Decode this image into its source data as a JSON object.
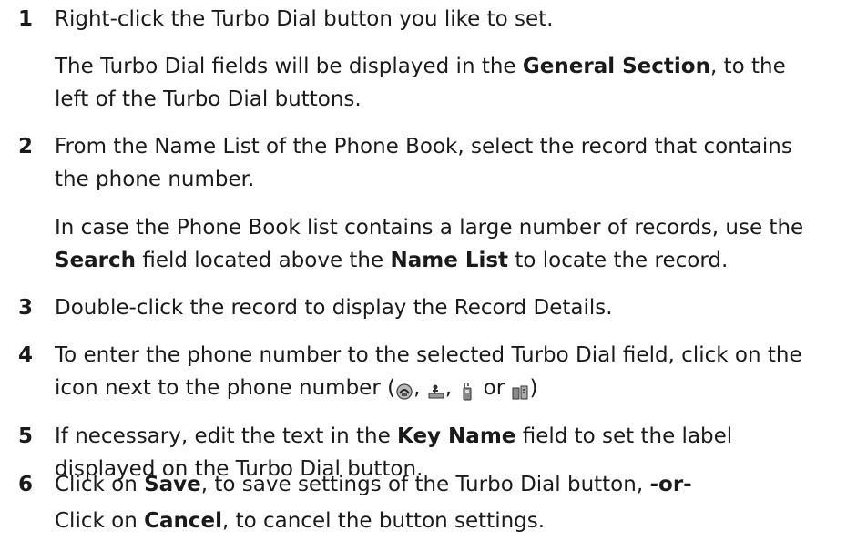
{
  "steps": [
    {
      "number": "1",
      "text": "Right-click the Turbo Dial button you like to set.",
      "note": {
        "line1_pre": "The Turbo Dial fields will be displayed in the ",
        "line1_bold": "General Section",
        "line1_post": ", to the",
        "line2": "left of the Turbo Dial buttons."
      }
    },
    {
      "number": "2",
      "line1": "From the Name List of the Phone Book, select the record that contains",
      "line2": "the phone number.",
      "note": {
        "line1": "In case the Phone Book list contains a large number of records, use the",
        "line2_bold1": "Search",
        "line2_mid": " field located above the ",
        "line2_bold2": "Name List",
        "line2_post": " to locate the record."
      }
    },
    {
      "number": "3",
      "text": "Double-click the record to display the Record Details."
    },
    {
      "number": "4",
      "line1": "To enter the phone number to the selected Turbo Dial field, click on the",
      "line2_pre": "icon next to the phone number (",
      "sep1": ", ",
      "sep2": ", ",
      "sep3": " or ",
      "line2_post": ")",
      "icons": [
        "home-phone-icon",
        "work-phone-icon",
        "mobile-phone-icon",
        "other-phone-icon"
      ]
    },
    {
      "number": "5",
      "line1_pre": "If necessary, edit the text in the ",
      "line1_bold": "Key Name",
      "line1_post": " field to set the label",
      "line2": "displayed on the Turbo Dial button."
    },
    {
      "number": "6",
      "line1_pre": "Click on ",
      "line1_bold": "Save",
      "line1_mid": ", to save settings of the Turbo Dial button, ",
      "line1_bold2": "-or-",
      "line2_pre": "Click on ",
      "line2_bold": "Cancel",
      "line2_post": ", to cancel the button settings."
    }
  ]
}
